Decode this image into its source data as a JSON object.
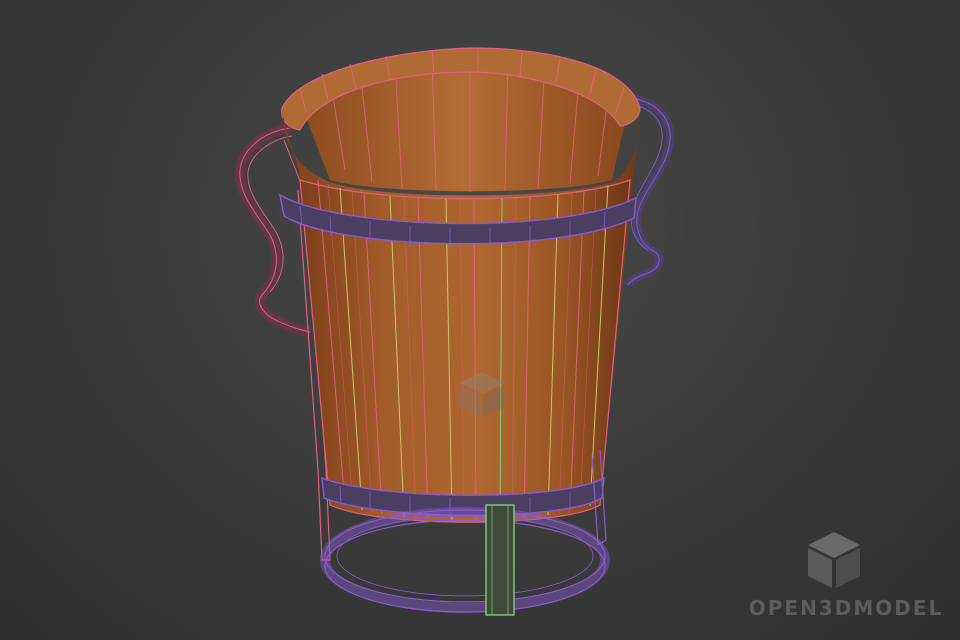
{
  "scene": {
    "subject": "wooden-bucket-wireframe",
    "background_color": "#3d3d3d",
    "wood_color": "#a8602c",
    "wire_colors": {
      "staves_pink": "#e0607e",
      "staves_yellow": "#c8c86a",
      "staves_green": "#7fd07f",
      "hoop_purple": "#8a5ad0",
      "handle_pink": "#e0607e"
    }
  },
  "watermark": {
    "text": "OPEN3DMODEL",
    "icon": "cube-logo-icon"
  }
}
